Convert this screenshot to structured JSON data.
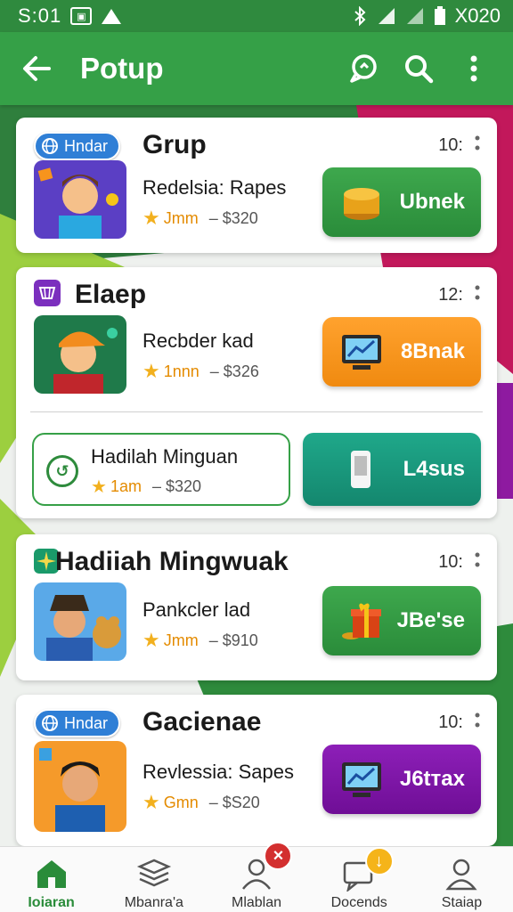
{
  "status_bar": {
    "time": "S:01",
    "carrier": "X020"
  },
  "app_bar": {
    "title": "Potup"
  },
  "cards": [
    {
      "badge": "Hndar",
      "title": "Grup",
      "time": "10:",
      "game": "Redelsia: Rapes",
      "rating": "Jmm",
      "price": "– $320",
      "action_label": "Ubnek",
      "action_color": "green"
    },
    {
      "title": "Elaep",
      "time": "12:",
      "game": "Recbder kad",
      "rating": "1nnn",
      "price": "– $326",
      "action_label": "8Bnak",
      "action_color": "orange",
      "reward": {
        "title": "Hadilah Minguan",
        "rating": "1am",
        "price": "– $320",
        "action_label": "L4sus",
        "action_color": "teal"
      }
    },
    {
      "title": "Hadiiah Mingwuak",
      "time": "10:",
      "game": "Pankcler lad",
      "rating": "Jmm",
      "price": "– $910",
      "action_label": "JBe'se",
      "action_color": "green"
    },
    {
      "badge": "Hndar",
      "title": "Gacienae",
      "time": "10:",
      "game": "Revlessia: Sapes",
      "rating": "Gmn",
      "price": "– $S20",
      "action_label": "J6tтax",
      "action_color": "purple"
    }
  ],
  "bottom_nav": [
    {
      "label": "Ioiaran",
      "icon": "home-icon",
      "active": true
    },
    {
      "label": "Mbanra'a",
      "icon": "stack-icon"
    },
    {
      "label": "Mlablan",
      "icon": "user-icon",
      "badge": "×"
    },
    {
      "label": "Docends",
      "icon": "chat-icon",
      "badge": "↓"
    },
    {
      "label": "Staiap",
      "icon": "profile-icon"
    }
  ],
  "colors": {
    "status_bar": "#2f8a3e",
    "app_bar": "#35a047",
    "green_button": "#35a047",
    "orange_button": "#f7941d",
    "teal_button": "#17977c",
    "purple_button": "#7d16a6",
    "badge_blue": "#2f7fd6"
  }
}
